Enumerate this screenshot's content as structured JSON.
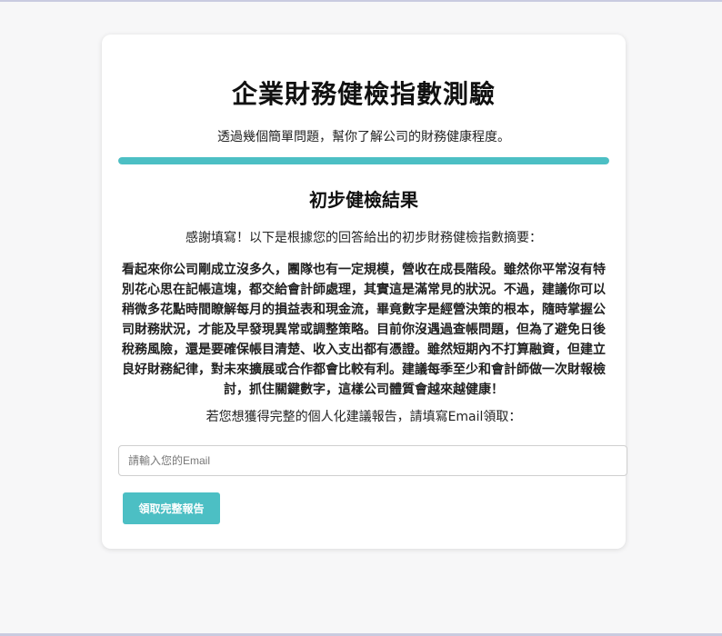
{
  "quiz": {
    "title": "企業財務健檢指數測驗",
    "subtitle": "透過幾個簡單問題，幫你了解公司的財務健康程度。",
    "progress_percent": 100,
    "accent_color": "#4cbfc4"
  },
  "result": {
    "heading": "初步健檢結果",
    "intro": "感謝填寫！以下是根據您的回答給出的初步財務健檢指數摘要：",
    "summary": "看起來你公司剛成立沒多久，團隊也有一定規模，營收在成長階段。雖然你平常沒有特別花心思在記帳這塊，都交給會計師處理，其實這是滿常見的狀況。不過，建議你可以稍微多花點時間瞭解每月的損益表和現金流，畢竟數字是經營決策的根本，隨時掌握公司財務狀況，才能及早發現異常或調整策略。目前你沒遇過查帳問題，但為了避免日後稅務風險，還是要確保帳目清楚、收入支出都有憑證。雖然短期內不打算融資，但建立良好財務紀律，對未來擴展或合作都會比較有利。建議每季至少和會計師做一次財報檢討，抓住關鍵數字，這樣公司體質會越來越健康！",
    "email_prompt": "若您想獲得完整的個人化建議報告，請填寫Email領取："
  },
  "form": {
    "email_placeholder": "請輸入您的Email",
    "email_value": "",
    "submit_label": "領取完整報告"
  }
}
